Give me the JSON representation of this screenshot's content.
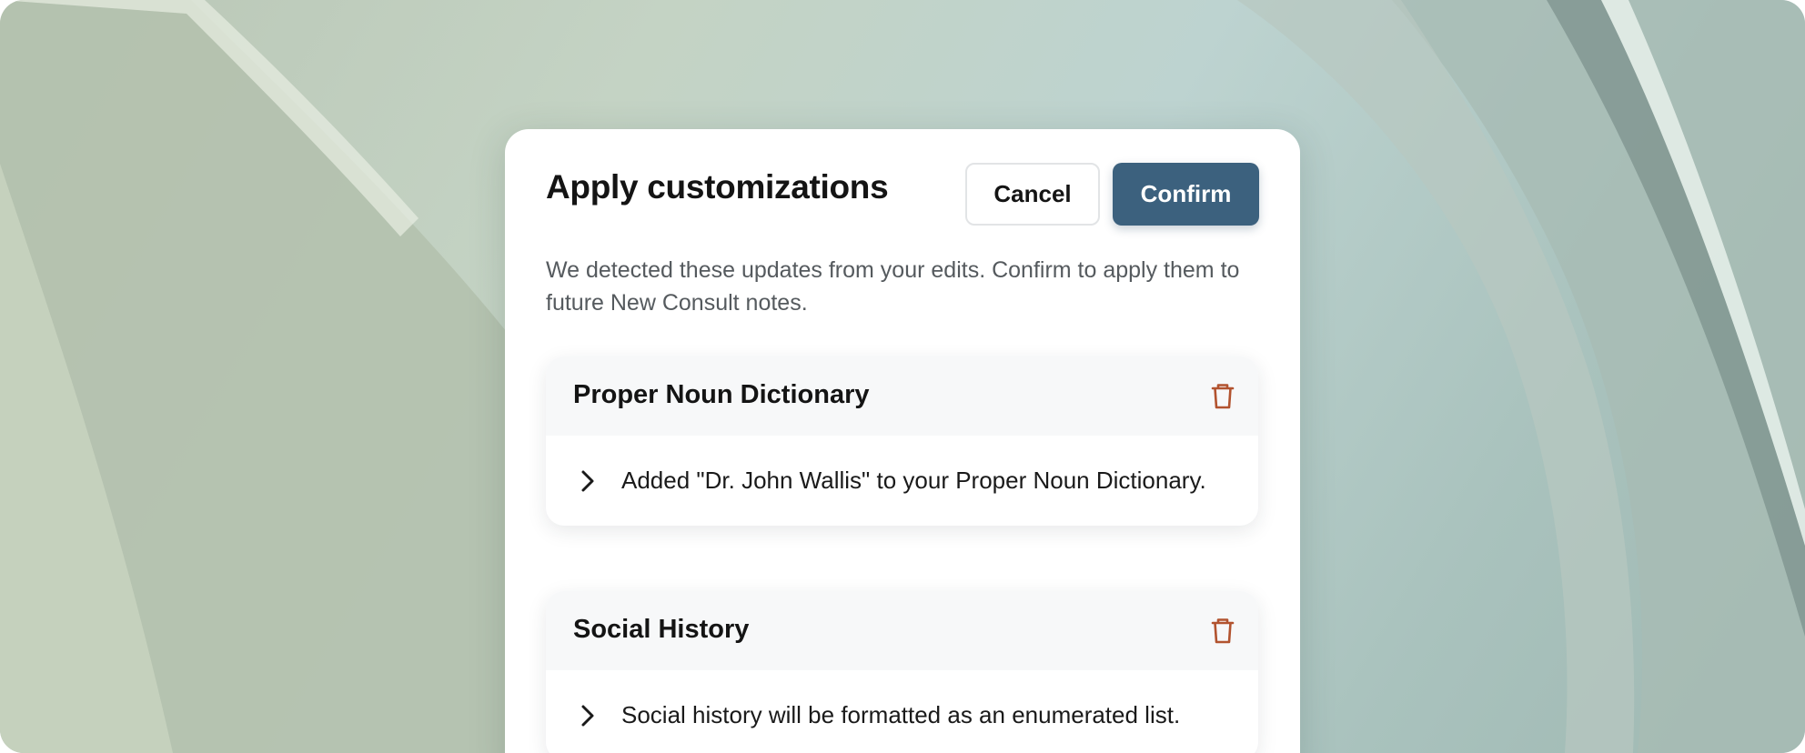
{
  "modal": {
    "title": "Apply customizations",
    "cancel_label": "Cancel",
    "confirm_label": "Confirm",
    "description": "We detected these updates from your edits. Confirm to apply them to future New Consult notes."
  },
  "cards": [
    {
      "title": "Proper Noun Dictionary",
      "detail": "Added \"Dr. John Wallis\" to your Proper Noun Dictionary.",
      "icon": "trash-icon"
    },
    {
      "title": "Social History",
      "detail": "Social history will be formatted as an enumerated list.",
      "icon": "trash-icon"
    }
  ],
  "colors": {
    "confirm_button": "#3c617e",
    "delete_icon": "#b2532f",
    "card_header": "#f7f8f9"
  }
}
